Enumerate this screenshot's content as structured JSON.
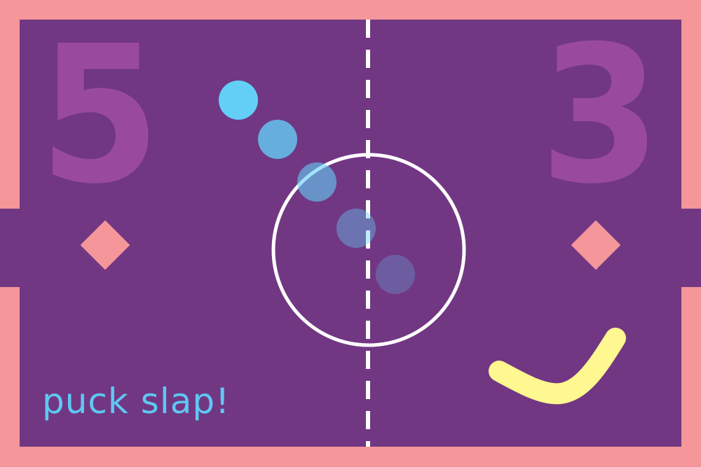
{
  "game": {
    "title": "puck slap!",
    "score_left": "5",
    "score_right": "3"
  },
  "colors": {
    "border": "#F4969A",
    "field": "#713783",
    "score": "#9A4A9D",
    "marker": "#F4969A",
    "lines": "#FFFFFF",
    "puck": "#63CFF7",
    "stick": "#FFF78F",
    "title": "#5FC8F2"
  },
  "icons": {
    "left_marker": "diamond-icon",
    "right_marker": "diamond-icon",
    "stick": "hockey-stick-icon",
    "puck": "puck-icon"
  }
}
